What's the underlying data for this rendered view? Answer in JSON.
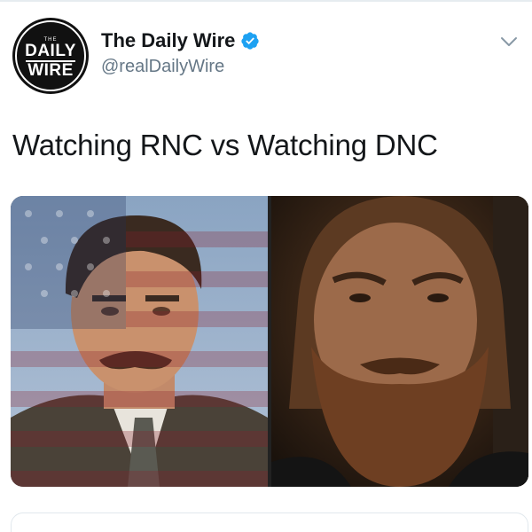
{
  "account": {
    "display_name": "The Daily Wire",
    "handle": "@realDailyWire",
    "verified": true,
    "avatar_logo": {
      "small_text": "THE",
      "line1": "DAILY",
      "line2": "WIRE"
    }
  },
  "tweet": {
    "text": "Watching RNC vs Watching DNC"
  },
  "media": {
    "images": [
      {
        "icon": "man-with-american-flag-overlay"
      },
      {
        "icon": "bearded-man-in-dark"
      }
    ]
  },
  "colors": {
    "verified_blue": "#1da1f2",
    "handle_gray": "#657786",
    "text_dark": "#14171a"
  }
}
